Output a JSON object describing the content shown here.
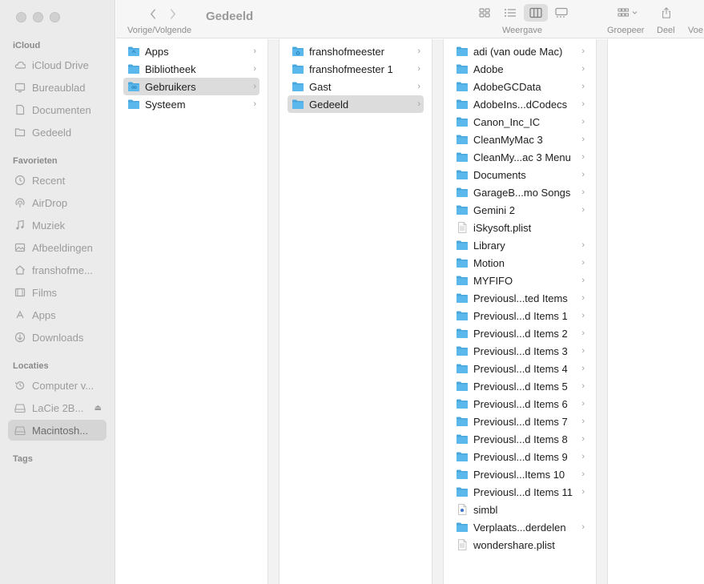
{
  "window": {
    "title": "Gedeeld"
  },
  "toolbar": {
    "nav_caption": "Vorige/Volgende",
    "view_caption": "Weergave",
    "group_caption": "Groepeer",
    "share_caption": "Deel",
    "more_caption": "Voe"
  },
  "sidebar": {
    "sections": [
      {
        "label": "iCloud",
        "items": [
          {
            "label": "iCloud Drive",
            "icon": "cloud-icon"
          },
          {
            "label": "Bureaublad",
            "icon": "desktop-icon"
          },
          {
            "label": "Documenten",
            "icon": "document-icon"
          },
          {
            "label": "Gedeeld",
            "icon": "shared-folder-icon"
          }
        ]
      },
      {
        "label": "Favorieten",
        "items": [
          {
            "label": "Recent",
            "icon": "clock-icon"
          },
          {
            "label": "AirDrop",
            "icon": "airdrop-icon"
          },
          {
            "label": "Muziek",
            "icon": "music-note-icon"
          },
          {
            "label": "Afbeeldingen",
            "icon": "photo-icon"
          },
          {
            "label": "franshofme...",
            "icon": "home-icon"
          },
          {
            "label": "Films",
            "icon": "film-icon"
          },
          {
            "label": "Apps",
            "icon": "apps-icon"
          },
          {
            "label": "Downloads",
            "icon": "download-icon"
          }
        ]
      },
      {
        "label": "Locaties",
        "items": [
          {
            "label": "Computer v...",
            "icon": "time-machine-icon"
          },
          {
            "label": "LaCie 2B...",
            "icon": "drive-icon"
          },
          {
            "label": "Macintosh...",
            "icon": "drive-icon"
          }
        ]
      },
      {
        "label": "Tags",
        "items": []
      }
    ]
  },
  "columns": [
    {
      "items": [
        {
          "name": "Apps",
          "type": "apps-folder",
          "chevron": true
        },
        {
          "name": "Bibliotheek",
          "type": "folder",
          "chevron": true
        },
        {
          "name": "Gebruikers",
          "type": "users-folder",
          "chevron": true,
          "selected": true
        },
        {
          "name": "Systeem",
          "type": "folder",
          "chevron": true
        }
      ]
    },
    {
      "items": [
        {
          "name": "franshofmeester",
          "type": "home-folder",
          "chevron": true
        },
        {
          "name": "franshofmeester 1",
          "type": "folder",
          "chevron": true
        },
        {
          "name": "Gast",
          "type": "folder",
          "chevron": true
        },
        {
          "name": "Gedeeld",
          "type": "folder",
          "chevron": true,
          "selected": true
        }
      ]
    },
    {
      "items": [
        {
          "name": "adi (van oude Mac)",
          "type": "folder",
          "chevron": true
        },
        {
          "name": "Adobe",
          "type": "folder",
          "chevron": true
        },
        {
          "name": "AdobeGCData",
          "type": "folder",
          "chevron": true
        },
        {
          "name": "AdobeIns...dCodecs",
          "type": "folder",
          "chevron": true
        },
        {
          "name": "Canon_Inc_IC",
          "type": "folder",
          "chevron": true
        },
        {
          "name": "CleanMyMac 3",
          "type": "folder",
          "chevron": true
        },
        {
          "name": "CleanMy...ac 3 Menu",
          "type": "folder",
          "chevron": true
        },
        {
          "name": "Documents",
          "type": "folder",
          "chevron": true
        },
        {
          "name": "GarageB...mo Songs",
          "type": "folder",
          "chevron": true
        },
        {
          "name": "Gemini 2",
          "type": "folder",
          "chevron": true
        },
        {
          "name": "iSkysoft.plist",
          "type": "file",
          "chevron": false
        },
        {
          "name": "Library",
          "type": "folder",
          "chevron": true
        },
        {
          "name": "Motion",
          "type": "folder",
          "chevron": true
        },
        {
          "name": "MYFIFO",
          "type": "folder",
          "chevron": true
        },
        {
          "name": "Previousl...ted Items",
          "type": "folder",
          "chevron": true
        },
        {
          "name": "Previousl...d Items 1",
          "type": "folder",
          "chevron": true
        },
        {
          "name": "Previousl...d Items 2",
          "type": "folder",
          "chevron": true
        },
        {
          "name": "Previousl...d Items 3",
          "type": "folder",
          "chevron": true
        },
        {
          "name": "Previousl...d Items 4",
          "type": "folder",
          "chevron": true
        },
        {
          "name": "Previousl...d Items 5",
          "type": "folder",
          "chevron": true
        },
        {
          "name": "Previousl...d Items 6",
          "type": "folder",
          "chevron": true
        },
        {
          "name": "Previousl...d Items 7",
          "type": "folder",
          "chevron": true
        },
        {
          "name": "Previousl...d Items 8",
          "type": "folder",
          "chevron": true
        },
        {
          "name": "Previousl...d Items 9",
          "type": "folder",
          "chevron": true
        },
        {
          "name": "Previousl...Items 10",
          "type": "folder",
          "chevron": true
        },
        {
          "name": "Previousl...d Items 11",
          "type": "folder",
          "chevron": true
        },
        {
          "name": "simbl",
          "type": "exec-file",
          "chevron": false
        },
        {
          "name": "Verplaats...derdelen",
          "type": "folder",
          "chevron": true
        },
        {
          "name": "wondershare.plist",
          "type": "file",
          "chevron": false
        }
      ]
    }
  ],
  "colors": {
    "folder": "#5ab8ec",
    "folder_tab": "#4aa7dd",
    "sidebar_bg": "#ebebeb",
    "selection": "#dcdcdc"
  }
}
